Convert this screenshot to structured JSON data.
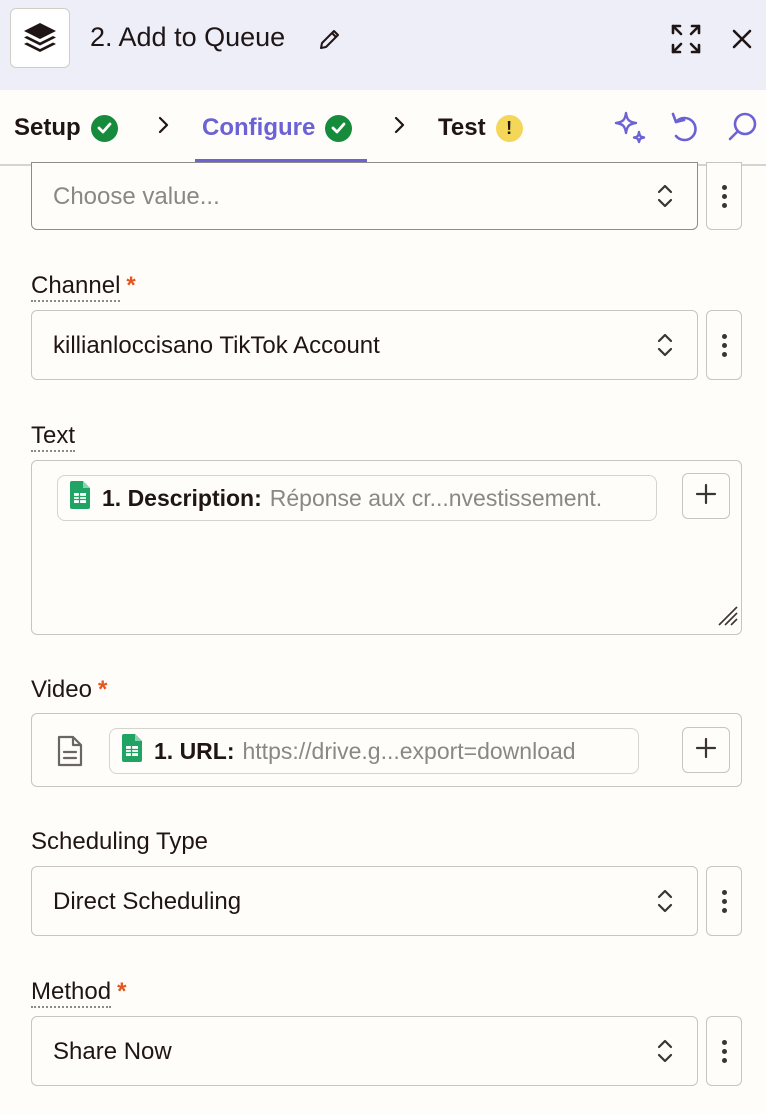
{
  "header": {
    "title": "2. Add to Queue"
  },
  "tabs": [
    {
      "label": "Setup",
      "status": "complete"
    },
    {
      "label": "Configure",
      "status": "complete",
      "active": true
    },
    {
      "label": "Test",
      "status": "warning",
      "badge": "!"
    }
  ],
  "toolbar_icons": [
    "sparkle-icon",
    "undo-icon",
    "search-icon"
  ],
  "fields": {
    "top_select": {
      "placeholder": "Choose value..."
    },
    "channel": {
      "label": "Channel",
      "required": "*",
      "value": "killianloccisano TikTok Account"
    },
    "text": {
      "label": "Text",
      "pill": {
        "key": "1. Description:",
        "value": "Réponse aux cr...nvestissement."
      }
    },
    "video": {
      "label": "Video",
      "required": "*",
      "pill": {
        "key": "1. URL:",
        "value": "https://drive.g...export=download"
      }
    },
    "scheduling_type": {
      "label": "Scheduling Type",
      "value": "Direct Scheduling"
    },
    "method": {
      "label": "Method",
      "required": "*",
      "value": "Share Now"
    }
  },
  "colors": {
    "accent": "#6b62d5",
    "success": "#168b3c",
    "warning": "#f4d658",
    "required": "#e3571f",
    "header_bg": "#eeeef9",
    "sheets_green": "#1fa463"
  }
}
